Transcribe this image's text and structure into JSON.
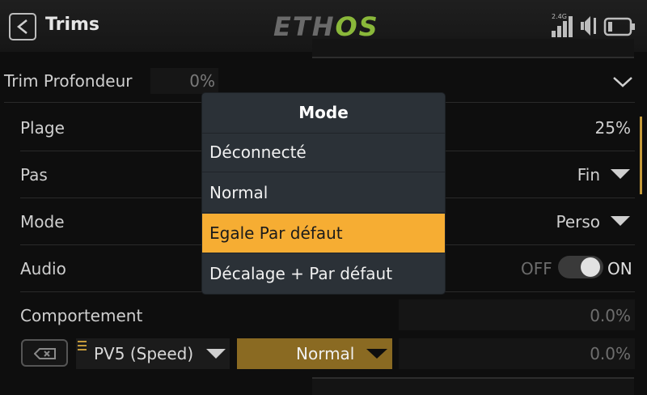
{
  "header": {
    "title": "Trims",
    "logo_main": "ETH",
    "logo_accent": "OS",
    "band_label": "2.4G"
  },
  "rows": {
    "trim": {
      "label": "Trim Profondeur",
      "value": "0%"
    },
    "plage": {
      "label": "Plage",
      "value": "25%"
    },
    "pas": {
      "label": "Pas",
      "value": "Fin"
    },
    "mode": {
      "label": "Mode",
      "value": "Perso"
    },
    "audio": {
      "label": "Audio",
      "off_label": "OFF",
      "on_label": "ON",
      "state": "on"
    },
    "comportement": {
      "label": "Comportement",
      "value": "0.0%"
    }
  },
  "bottom_row": {
    "source": "PV5 (Speed)",
    "mode": "Normal",
    "value": "0.0%"
  },
  "popup": {
    "title": "Mode",
    "options": [
      {
        "label": "Déconnecté",
        "selected": false
      },
      {
        "label": "Normal",
        "selected": false
      },
      {
        "label": "Egale Par défaut",
        "selected": true
      },
      {
        "label": "Décalage + Par défaut",
        "selected": false
      }
    ]
  },
  "colors": {
    "accent": "#f6ad33",
    "popup_bg": "#2b3137",
    "logo_green": "#8ab83a",
    "background": "#0e0e0e"
  },
  "icons": {
    "back": "chevron-left-icon",
    "signal": "signal-bars-icon",
    "volume": "speaker-icon",
    "battery": "battery-icon",
    "expand": "chevron-down-icon",
    "clear": "backspace-icon"
  }
}
